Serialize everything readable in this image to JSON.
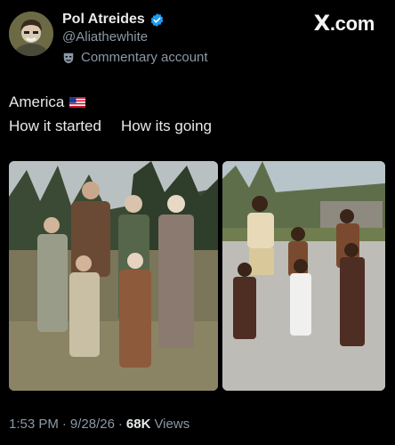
{
  "author": {
    "display_name": "Pol Atreides",
    "handle": "@Aliathewhite",
    "account_label": "Commentary account",
    "avatar_icon": "cartoon-avatar",
    "verified_icon": "verified-badge-icon",
    "verified_color": "#1d9bf0"
  },
  "watermark": {
    "x": "X",
    "rest": ".com"
  },
  "tweet": {
    "line1_text": "America",
    "line1_emoji": "us-flag",
    "line2_left": "How it started",
    "line2_right": "How its going"
  },
  "media": [
    {
      "name": "pilgrim-family-photo",
      "description_visible": false
    },
    {
      "name": "modern-family-photo",
      "description_visible": false
    }
  ],
  "meta": {
    "time": "1:53 PM",
    "sep1": "·",
    "date": "9/28/26",
    "sep2": "·",
    "views_count": "68K",
    "views_label": "Views"
  },
  "colors": {
    "background": "#000000",
    "text_primary": "#e7e9ea",
    "text_secondary": "#8b98a5"
  }
}
